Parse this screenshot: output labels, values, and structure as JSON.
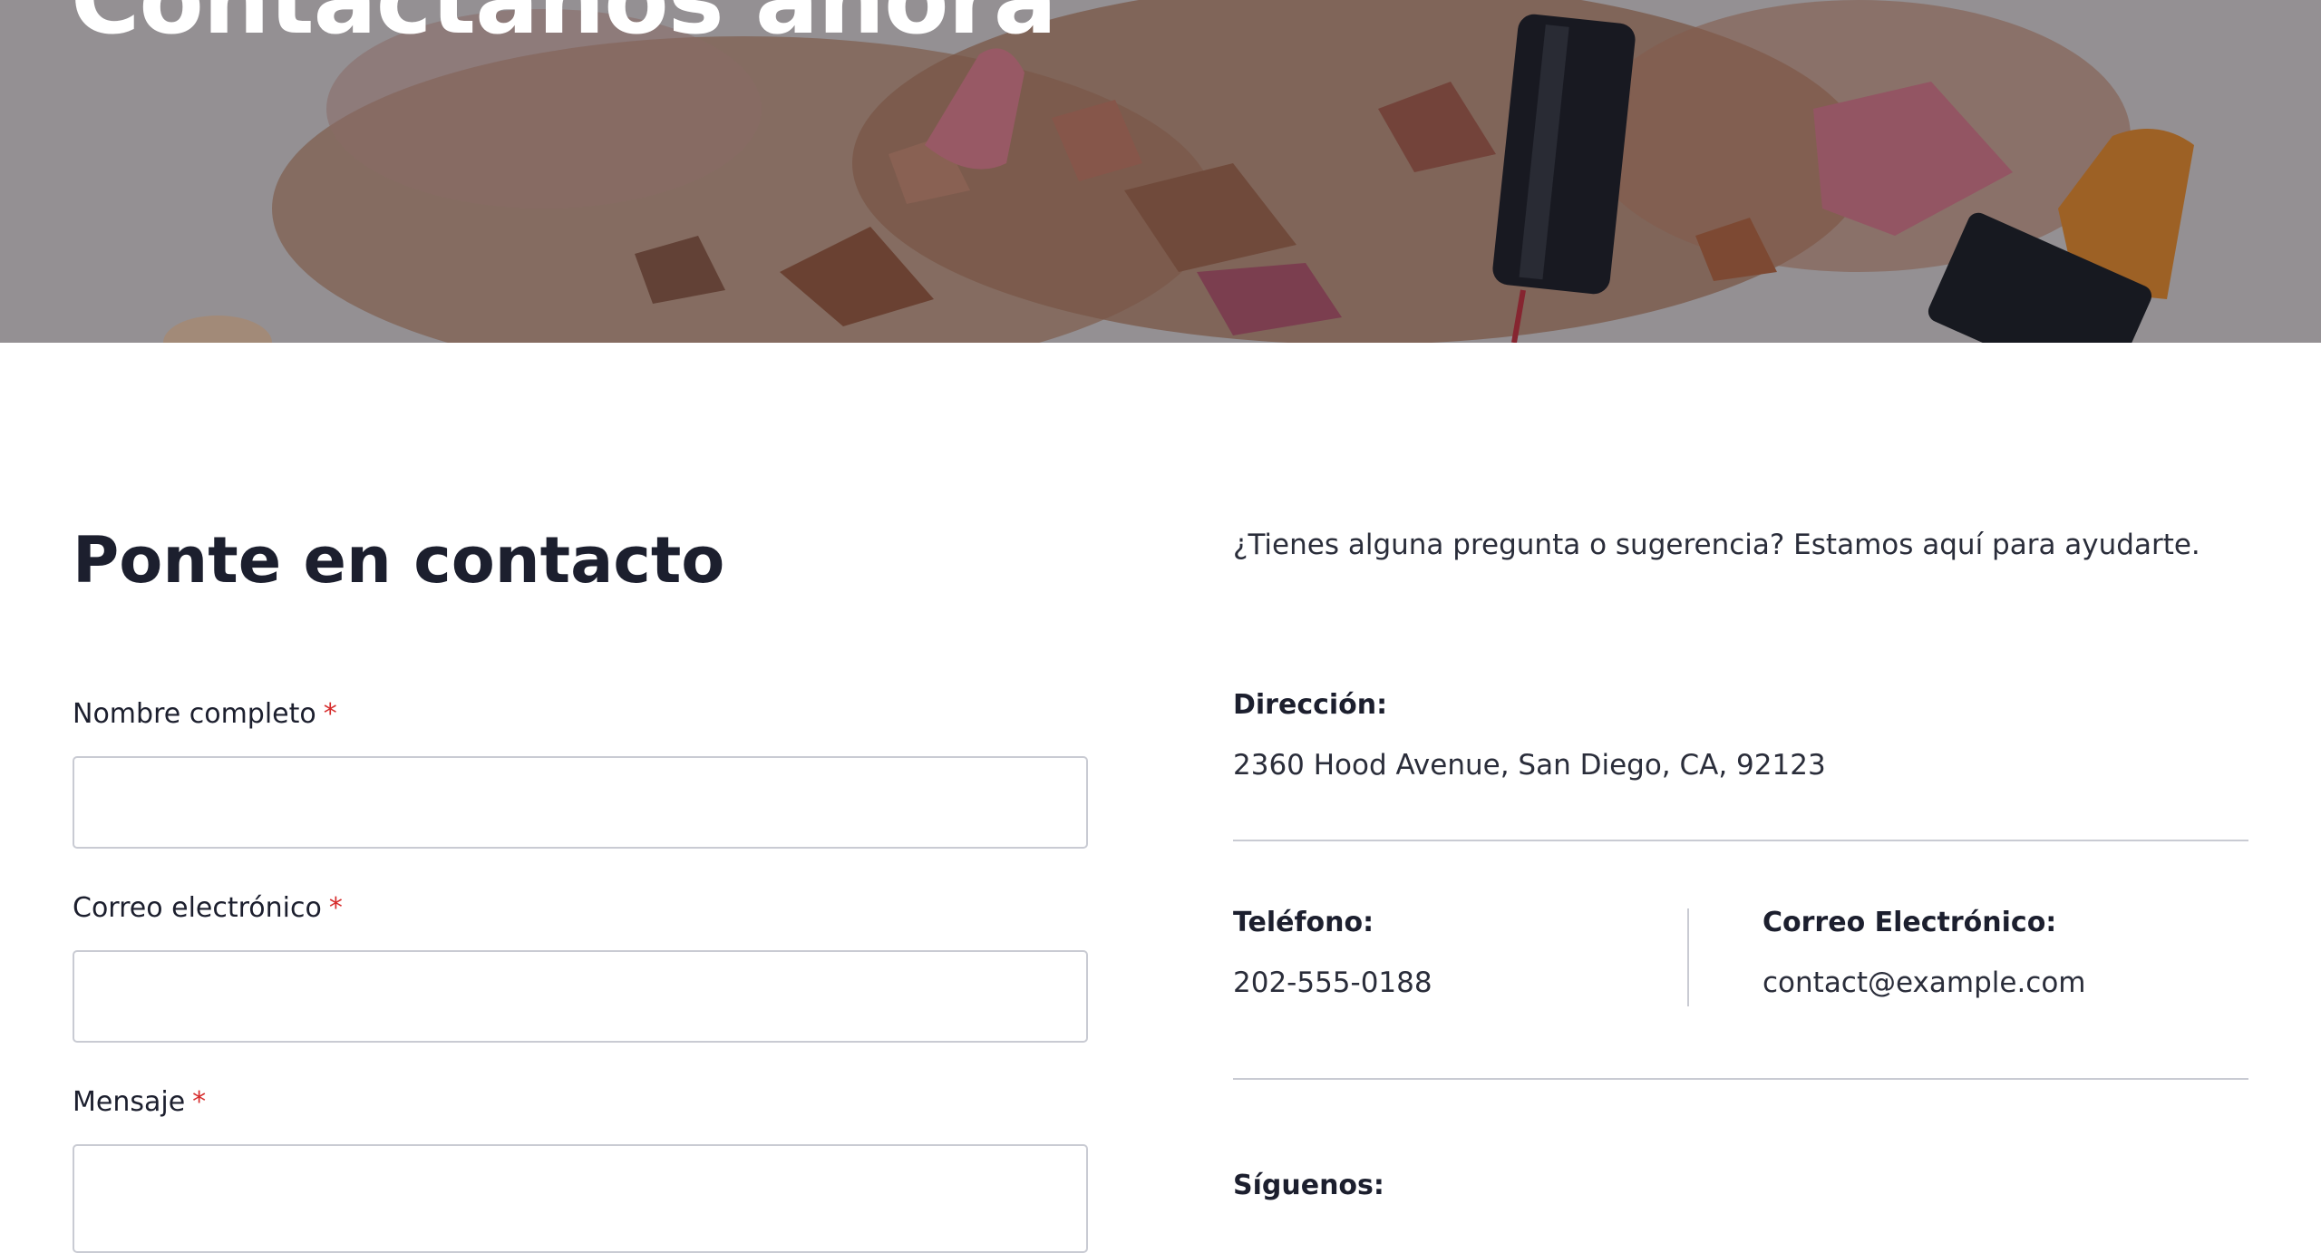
{
  "hero": {
    "title": "Contáctanos ahora"
  },
  "form": {
    "heading": "Ponte en contacto",
    "required_mark": "*",
    "fields": {
      "name": {
        "label": "Nombre completo",
        "value": "",
        "placeholder": ""
      },
      "email": {
        "label": "Correo electrónico",
        "value": "",
        "placeholder": ""
      },
      "message": {
        "label": "Mensaje",
        "value": "",
        "placeholder": ""
      }
    }
  },
  "info": {
    "intro": "¿Tienes alguna pregunta o sugerencia? Estamos aquí para ayudarte.",
    "address": {
      "label": "Dirección:",
      "value": "2360 Hood Avenue, San Diego, CA, 92123"
    },
    "phone": {
      "label": "Teléfono:",
      "value": "202-555-0188"
    },
    "email": {
      "label": "Correo Electrónico:",
      "value": "contact@example.com"
    },
    "social": {
      "label": "Síguenos:"
    }
  },
  "colors": {
    "text_dark": "#1c1f2e",
    "required": "#d62b2b",
    "border": "#c9cbd3"
  }
}
